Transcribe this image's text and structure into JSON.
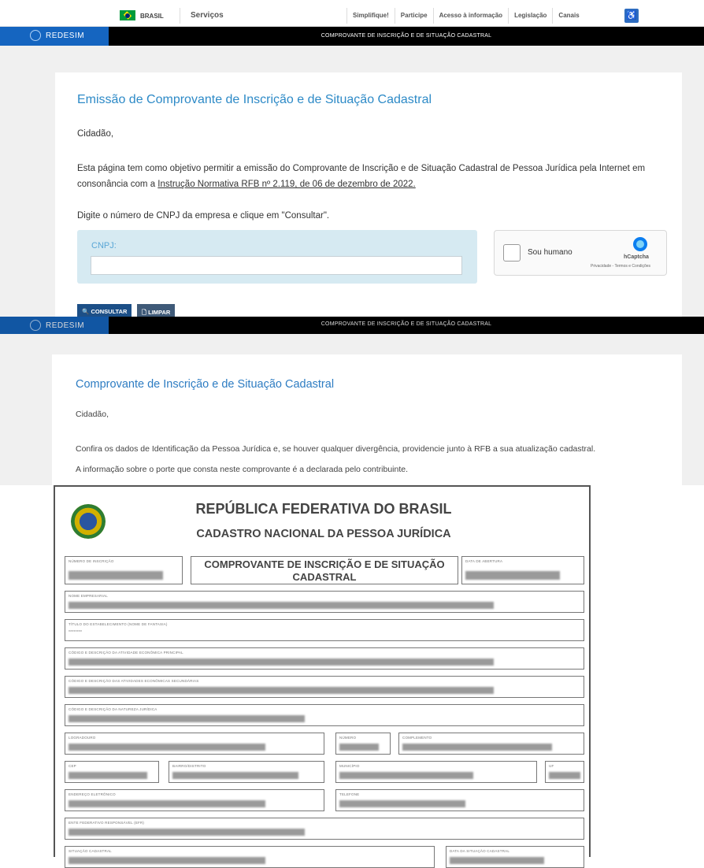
{
  "govbar": {
    "country": "BRASIL",
    "services": "Serviços",
    "links": [
      "Simplifique!",
      "Participe",
      "Acesso à informação",
      "Legislação",
      "Canais"
    ]
  },
  "header": {
    "logo_text": "REDESIM",
    "title": "COMPROVANTE DE INSCRIÇÃO E DE SITUAÇÃO CADASTRAL"
  },
  "form": {
    "heading": "Emissão de Comprovante de Inscrição e de Situação Cadastral",
    "greeting": "Cidadão,",
    "intro_1": "Esta página tem como objetivo permitir a emissão do Comprovante de Inscrição e de Situação Cadastral de Pessoa Jurídica pela Internet em",
    "intro_2a": "consonância com a ",
    "intro_link": "Instrução Normativa RFB nº 2.119, de 06 de dezembro de 2022.",
    "instruction": "Digite o número de CNPJ da empresa e clique em \"Consultar\".",
    "cnpj_label": "CNPJ:",
    "cnpj_value": "",
    "captcha_label": "Sou humano",
    "captcha_brand": "hCaptcha",
    "captcha_terms": "Privacidade - Termos e Condições",
    "consult_button": "CONSULTAR",
    "clear_button": "LIMPAR"
  },
  "result": {
    "header_title": "COMPROVANTE DE INSCRIÇÃO E DE SITUAÇÃO CADASTRAL",
    "heading": "Comprovante de Inscrição e de Situação Cadastral",
    "greeting": "Cidadão,",
    "line1": "Confira os dados de Identificação da Pessoa Jurídica e, se houver qualquer divergência, providencie junto à RFB a sua atualização cadastral.",
    "line2": "A informação sobre o porte que consta neste comprovante é a declarada pelo contribuinte."
  },
  "document": {
    "title1": "REPÚBLICA FEDERATIVA DO BRASIL",
    "title2": "CADASTRO NACIONAL DA PESSOA JURÍDICA",
    "comp_line1": "COMPROVANTE DE INSCRIÇÃO E DE SITUAÇÃO",
    "comp_line2": "CADASTRAL",
    "fields": {
      "numero_inscricao": "NÚMERO DE INSCRIÇÃO",
      "data_abertura": "DATA DE ABERTURA",
      "nome_empresarial": "NOME EMPRESARIAL",
      "titulo": "TÍTULO DO ESTABELECIMENTO (NOME DE FANTASIA)",
      "titulo_value": "********",
      "cnae_principal": "CÓDIGO E DESCRIÇÃO DA ATIVIDADE ECONÔMICA PRINCIPAL",
      "cnae_secundarias": "CÓDIGO E DESCRIÇÃO DAS ATIVIDADES ECONÔMICAS SECUNDÁRIAS",
      "natureza": "CÓDIGO E DESCRIÇÃO DA NATUREZA JURÍDICA",
      "logradouro": "LOGRADOURO",
      "numero": "NÚMERO",
      "complemento": "COMPLEMENTO",
      "cep": "CEP",
      "bairro": "BAIRRO/DISTRITO",
      "municipio": "MUNICÍPIO",
      "uf": "UF",
      "email": "ENDEREÇO ELETRÔNICO",
      "telefone": "TELEFONE",
      "efr": "ENTE FEDERATIVO RESPONSÁVEL (EFR)",
      "situacao": "SITUAÇÃO CADASTRAL",
      "data_situacao": "DATA DA SITUAÇÃO CADASTRAL"
    }
  }
}
